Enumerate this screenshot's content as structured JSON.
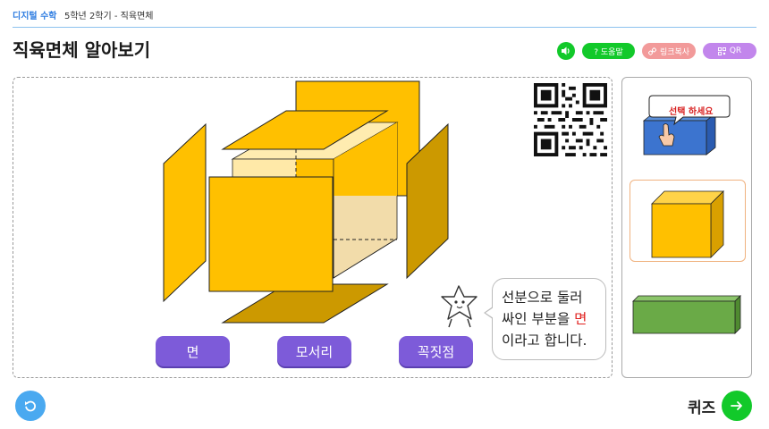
{
  "header": {
    "subject": "디지털 수학",
    "breadcrumb": "5학년 2학기 - 직육면체"
  },
  "title": "직육면체 알아보기",
  "toolbar": {
    "help_label": "? 도움말",
    "link_label": "링크복사",
    "qr_label": "QR"
  },
  "stage": {
    "speech_part1": "선분으로  둘러",
    "speech_part2": "싸인 부분을 ",
    "speech_highlight": "면",
    "speech_part3": "이라고 합니다.",
    "terms": [
      "면",
      "모서리",
      "꼭짓점"
    ]
  },
  "side_panel": {
    "select_label": "선택 하세요",
    "active_index": 1
  },
  "footer": {
    "quiz_label": "퀴즈"
  },
  "colors": {
    "accent_blue": "#2f7de1",
    "green": "#12c92a",
    "term_purple": "#7d5bd9",
    "face_yellow": "#ffc000",
    "face_dark": "#cc9900",
    "highlight_red": "#e0201e"
  },
  "icons": {
    "sound": "speaker-icon",
    "link": "link-icon",
    "qr": "qr-icon",
    "reset": "reset-icon",
    "quiz": "arrow-right-icon"
  }
}
